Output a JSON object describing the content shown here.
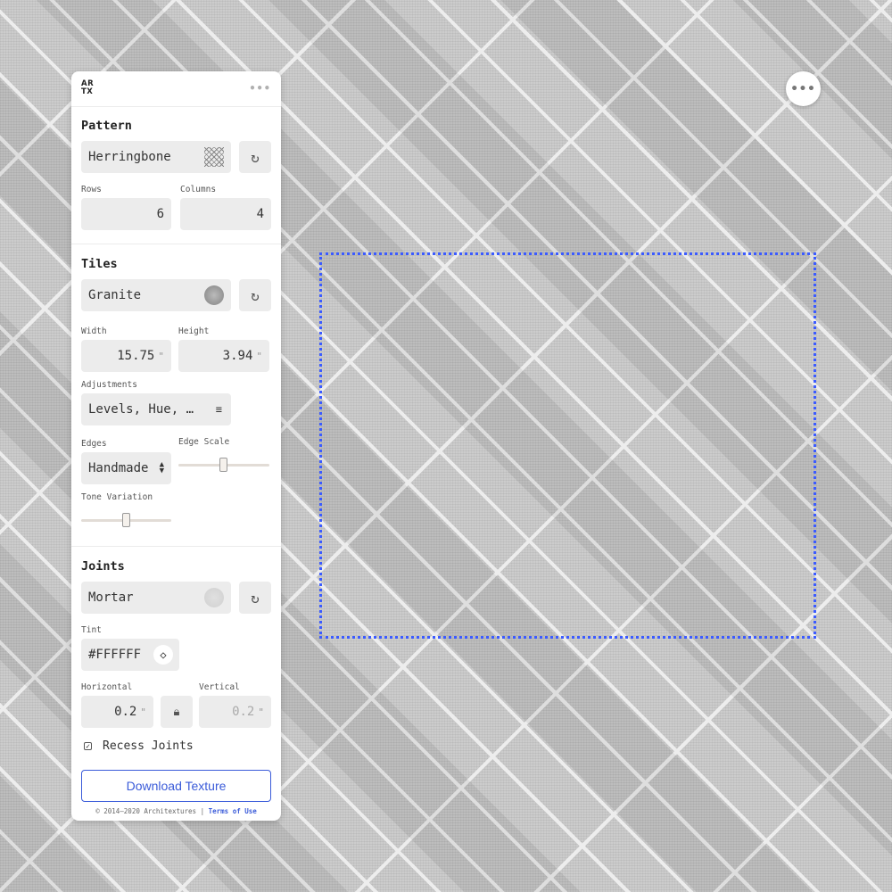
{
  "header": {
    "logo_top": "AR",
    "logo_bottom": "TX",
    "more_label": "•••"
  },
  "fab": {
    "label": "•••"
  },
  "pattern": {
    "title": "Pattern",
    "value": "Herringbone",
    "swatch_icon": "herringbone-pattern-icon",
    "refresh_icon": "refresh-icon",
    "rows_label": "Rows",
    "rows_value": "6",
    "columns_label": "Columns",
    "columns_value": "4"
  },
  "tiles": {
    "title": "Tiles",
    "material": "Granite",
    "refresh_icon": "refresh-icon",
    "width_label": "Width",
    "width_value": "15.75",
    "height_label": "Height",
    "height_value": "3.94",
    "unit": "\"",
    "adjustments_label": "Adjustments",
    "adjustments_value": "Levels, Hue, …",
    "edges_label": "Edges",
    "edges_value": "Handmade",
    "edge_scale_label": "Edge Scale",
    "edge_scale_level": 0.5,
    "tone_variation_label": "Tone Variation",
    "tone_variation_level": 0.5
  },
  "joints": {
    "title": "Joints",
    "material": "Mortar",
    "refresh_icon": "refresh-icon",
    "tint_label": "Tint",
    "tint_value": "#FFFFFF",
    "horizontal_label": "Horizontal",
    "horizontal_value": "0.2",
    "vertical_label": "Vertical",
    "vertical_value": "0.2",
    "unit": "\"",
    "recess_label": "Recess Joints",
    "recess_checked": true
  },
  "download_label": "Download Texture",
  "footer": {
    "copyright": "© 2014–2020 Architextures |",
    "terms": "Terms of Use"
  },
  "colors": {
    "accent": "#3a5bd9",
    "selection": "#3b5bff",
    "field_bg": "#ececec"
  }
}
